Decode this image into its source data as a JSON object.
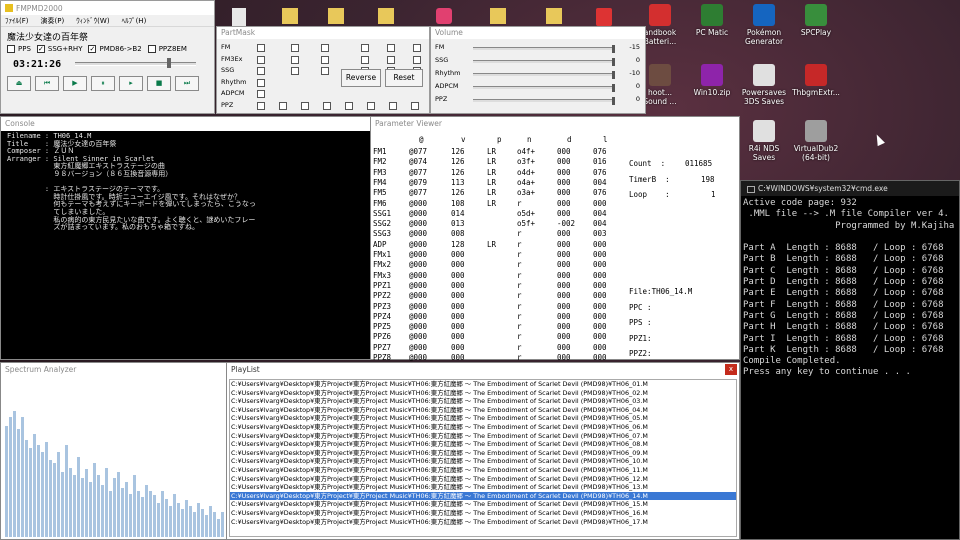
{
  "player": {
    "title": "FMPMD2000",
    "menu": [
      "ﾌｧｲﾙ(F)",
      "演奏(P)",
      "ｳｨﾝﾄﾞｳ(W)",
      "ﾍﾙﾌﾟ(H)"
    ],
    "song_title": "魔法少女達の百年祭",
    "options": [
      "PPS",
      "SSG+RHY",
      "PMD86->B2",
      "PPZ8EM"
    ],
    "options_checked": [
      false,
      true,
      true,
      false
    ],
    "time": "03:21:26",
    "seek_fraction": 0.76,
    "buttons": [
      "⏏",
      "⏮",
      "▶",
      "⏸",
      "▸",
      "■",
      "⏭"
    ]
  },
  "partmask": {
    "title": "PartMask",
    "rows": [
      "FM",
      "FM3Ex",
      "SSG",
      "Rhythm",
      "ADPCM",
      "PPZ"
    ],
    "reverse_label": "Reverse",
    "reset_label": "Reset"
  },
  "volume": {
    "title": "Volume",
    "rows": [
      {
        "label": "FM",
        "value": "-15",
        "level": 0.98
      },
      {
        "label": "SSG",
        "value": "0",
        "level": 0.98
      },
      {
        "label": "Rhythm",
        "value": "-10",
        "level": 0.98
      },
      {
        "label": "ADPCM",
        "value": "0",
        "level": 0.98
      },
      {
        "label": "PPZ",
        "value": "0",
        "level": 0.98
      }
    ]
  },
  "console": {
    "title": "Console",
    "lines": [
      "Filename : TH06_14.M",
      "Title    : 魔法少女達の百年祭",
      "Composer : ＺＵＮ",
      "Arranger : Silent Sinner in Scarlet",
      "           東方紅魔郷エキストラステージの曲",
      "           ９８バージョン（８６互換音源専用）",
      "",
      "         : エキストラステージのテーマです。",
      "           時計仕掛風です。時折ニューエイジ風です。それはなぜか？",
      "           何もテーマも考えずにキーボードを弾いてしまったら、こうなっ",
      "           てしまいました。",
      "           私の病的の東方民見たいな曲です。よく聴くと、謎めいたフレー",
      "           ズが詰まっています。私のおもちゃ箱ですね。"
    ]
  },
  "param": {
    "title": "Parameter Viewer",
    "headers": [
      "@",
      "v",
      "p",
      "n",
      "d",
      "l"
    ],
    "rows": [
      [
        "FM1",
        "@077",
        "126",
        "LR",
        "o4f+",
        "000",
        "076"
      ],
      [
        "FM2",
        "@074",
        "126",
        "LR",
        "o3f+",
        "000",
        "016"
      ],
      [
        "FM3",
        "@077",
        "126",
        "LR",
        "o4d+",
        "000",
        "076"
      ],
      [
        "FM4",
        "@079",
        "113",
        "LR",
        "o4a+",
        "000",
        "004"
      ],
      [
        "FM5",
        "@077",
        "126",
        "LR",
        "o3a+",
        "000",
        "076"
      ],
      [
        "FM6",
        "@000",
        "108",
        "LR",
        "r",
        "000",
        "000"
      ],
      [
        "SSG1",
        "@000",
        "014",
        "",
        "o5d+",
        "000",
        "004"
      ],
      [
        "SSG2",
        "@000",
        "013",
        "",
        "o5f+",
        "-002",
        "004"
      ],
      [
        "SSG3",
        "@000",
        "008",
        "",
        "r",
        "000",
        "003"
      ],
      [
        "ADP",
        "@000",
        "128",
        "LR",
        "r",
        "000",
        "000"
      ],
      [
        "FMx1",
        "@000",
        "000",
        "",
        "r",
        "000",
        "000"
      ],
      [
        "FMx2",
        "@000",
        "000",
        "",
        "r",
        "000",
        "000"
      ],
      [
        "FMx3",
        "@000",
        "000",
        "",
        "r",
        "000",
        "000"
      ],
      [
        "PPZ1",
        "@000",
        "000",
        "",
        "r",
        "000",
        "000"
      ],
      [
        "PPZ2",
        "@000",
        "000",
        "",
        "r",
        "000",
        "000"
      ],
      [
        "PPZ3",
        "@000",
        "000",
        "",
        "r",
        "000",
        "000"
      ],
      [
        "PPZ4",
        "@000",
        "000",
        "",
        "r",
        "000",
        "000"
      ],
      [
        "PPZ5",
        "@000",
        "000",
        "",
        "r",
        "000",
        "000"
      ],
      [
        "PPZ6",
        "@000",
        "000",
        "",
        "r",
        "000",
        "000"
      ],
      [
        "PPZ7",
        "@000",
        "000",
        "",
        "r",
        "000",
        "000"
      ],
      [
        "PPZ8",
        "@000",
        "000",
        "",
        "r",
        "000",
        "000"
      ]
    ],
    "count_label": "Count  :",
    "count_value": "011685",
    "timerb_label": "TimerB  :",
    "timerb_value": "198",
    "loop_label": "Loop    :",
    "loop_value": "1",
    "file_label": "File:TH06_14.M",
    "ppc_label": "PPC :",
    "pps_label": "PPS :",
    "ppz1_label": "PPZ1:",
    "ppz2_label": "PPZ2:"
  },
  "spectrum": {
    "title": "Spectrum Analyzer",
    "levels": [
      0.72,
      0.78,
      0.82,
      0.7,
      0.78,
      0.63,
      0.58,
      0.67,
      0.6,
      0.55,
      0.62,
      0.5,
      0.48,
      0.55,
      0.42,
      0.6,
      0.45,
      0.4,
      0.52,
      0.38,
      0.44,
      0.36,
      0.48,
      0.4,
      0.34,
      0.45,
      0.3,
      0.38,
      0.42,
      0.32,
      0.36,
      0.28,
      0.4,
      0.3,
      0.26,
      0.34,
      0.3,
      0.27,
      0.22,
      0.3,
      0.25,
      0.2,
      0.28,
      0.22,
      0.18,
      0.24,
      0.2,
      0.16,
      0.22,
      0.18,
      0.14,
      0.2,
      0.16,
      0.12,
      0.16
    ]
  },
  "playlist": {
    "title": "PlayList",
    "close": "x",
    "selected_index": 13,
    "items": [
      "C:¥Users¥lvarg¥Desktop¥東方Project¥東方Project Music¥TH06:東方紅魔郷 ～ The Embodiment of Scarlet Devil (PMD98)¥TH06_01.M",
      "C:¥Users¥lvarg¥Desktop¥東方Project¥東方Project Music¥TH06:東方紅魔郷 ～ The Embodiment of Scarlet Devil (PMD98)¥TH06_02.M",
      "C:¥Users¥lvarg¥Desktop¥東方Project¥東方Project Music¥TH06:東方紅魔郷 ～ The Embodiment of Scarlet Devil (PMD98)¥TH06_03.M",
      "C:¥Users¥lvarg¥Desktop¥東方Project¥東方Project Music¥TH06:東方紅魔郷 ～ The Embodiment of Scarlet Devil (PMD98)¥TH06_04.M",
      "C:¥Users¥lvarg¥Desktop¥東方Project¥東方Project Music¥TH06:東方紅魔郷 ～ The Embodiment of Scarlet Devil (PMD98)¥TH06_05.M",
      "C:¥Users¥lvarg¥Desktop¥東方Project¥東方Project Music¥TH06:東方紅魔郷 ～ The Embodiment of Scarlet Devil (PMD98)¥TH06_06.M",
      "C:¥Users¥lvarg¥Desktop¥東方Project¥東方Project Music¥TH06:東方紅魔郷 ～ The Embodiment of Scarlet Devil (PMD98)¥TH06_07.M",
      "C:¥Users¥lvarg¥Desktop¥東方Project¥東方Project Music¥TH06:東方紅魔郷 ～ The Embodiment of Scarlet Devil (PMD98)¥TH06_08.M",
      "C:¥Users¥lvarg¥Desktop¥東方Project¥東方Project Music¥TH06:東方紅魔郷 ～ The Embodiment of Scarlet Devil (PMD98)¥TH06_09.M",
      "C:¥Users¥lvarg¥Desktop¥東方Project¥東方Project Music¥TH06:東方紅魔郷 ～ The Embodiment of Scarlet Devil (PMD98)¥TH06_10.M",
      "C:¥Users¥lvarg¥Desktop¥東方Project¥東方Project Music¥TH06:東方紅魔郷 ～ The Embodiment of Scarlet Devil (PMD98)¥TH06_11.M",
      "C:¥Users¥lvarg¥Desktop¥東方Project¥東方Project Music¥TH06:東方紅魔郷 ～ The Embodiment of Scarlet Devil (PMD98)¥TH06_12.M",
      "C:¥Users¥lvarg¥Desktop¥東方Project¥東方Project Music¥TH06:東方紅魔郷 ～ The Embodiment of Scarlet Devil (PMD98)¥TH06_13.M",
      "C:¥Users¥lvarg¥Desktop¥東方Project¥東方Project Music¥TH06:東方紅魔郷 ～ The Embodiment of Scarlet Devil (PMD98)¥TH06_14.M",
      "C:¥Users¥lvarg¥Desktop¥東方Project¥東方Project Music¥TH06:東方紅魔郷 ～ The Embodiment of Scarlet Devil (PMD98)¥TH06_15.M",
      "C:¥Users¥lvarg¥Desktop¥東方Project¥東方Project Music¥TH06:東方紅魔郷 ～ The Embodiment of Scarlet Devil (PMD98)¥TH06_16.M",
      "C:¥Users¥lvarg¥Desktop¥東方Project¥東方Project Music¥TH06:東方紅魔郷 ～ The Embodiment of Scarlet Devil (PMD98)¥TH06_17.M"
    ]
  },
  "cmd": {
    "title": "C:¥WINDOWS¥system32¥cmd.exe",
    "lines": [
      "Active code page: 932",
      " .MML file --> .M file Compiler ver 4.",
      "                 Programmed by M.Kajiha",
      "",
      "Part A  Length : 8688   / Loop : 6768",
      "Part B  Length : 8688   / Loop : 6768",
      "Part C  Length : 8688   / Loop : 6768",
      "Part D  Length : 8688   / Loop : 6768",
      "Part E  Length : 8688   / Loop : 6768",
      "Part F  Length : 8688   / Loop : 6768",
      "Part G  Length : 8688   / Loop : 6768",
      "Part H  Length : 8688   / Loop : 6768",
      "Part I  Length : 8688   / Loop : 6768",
      "Part K  Length : 8688   / Loop : 6768",
      "Compile Completed.",
      "Press any key to continue . . ."
    ]
  },
  "desktop_icons": [
    {
      "label": "andbook\nBatteri...",
      "icon": "pdf-icon",
      "color": "#d32f2f"
    },
    {
      "label": "PC Matic",
      "icon": "pc-matic-icon",
      "color": "#2e7d32"
    },
    {
      "label": "Pokémon\nGenerator",
      "icon": "pokemon-icon",
      "color": "#1565c0"
    },
    {
      "label": "SPCPlay",
      "icon": "spcplay-icon",
      "color": "#388e3c"
    },
    {
      "label": "hoot...\nSound ...",
      "icon": "hoot-icon",
      "color": "#6d4c41"
    },
    {
      "label": "Win10.zip",
      "icon": "zip-icon",
      "color": "#8e24aa"
    },
    {
      "label": "Powersaves\n3DS Saves",
      "icon": "folder-doc-icon",
      "color": "#e0e0e0"
    },
    {
      "label": "ThbgmExtr...",
      "icon": "thbgm-icon",
      "color": "#c62828"
    },
    {
      "label": "R4i NDS\nSaves",
      "icon": "folder-doc-icon",
      "color": "#e0e0e0"
    },
    {
      "label": "VirtualDub2\n(64-bit)",
      "icon": "virtualdub-icon",
      "color": "#9e9e9e"
    }
  ]
}
